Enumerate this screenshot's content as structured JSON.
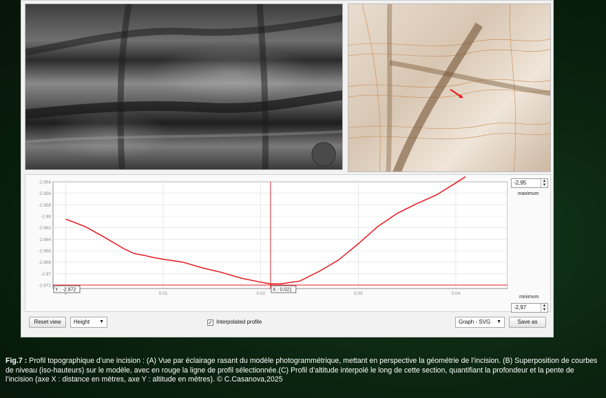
{
  "plot": {
    "y_ticks": [
      "-2.954",
      "-2.956",
      "-2.958",
      "-2.96",
      "-2.962",
      "-2.964",
      "-2.966",
      "-2.968",
      "-2.97",
      "-2.972"
    ],
    "x_ticks": [
      "0",
      "0.01",
      "0.02",
      "0.03",
      "0.04"
    ],
    "cursor_y_label": "Y : -2.972",
    "cursor_x_label": "X : 0.021",
    "line_color": "#e8141c"
  },
  "chart_data": {
    "type": "line",
    "x": [
      0,
      0.002,
      0.004,
      0.006,
      0.007,
      0.008,
      0.009,
      0.01,
      0.012,
      0.014,
      0.016,
      0.018,
      0.02,
      0.021,
      0.022,
      0.024,
      0.026,
      0.028,
      0.03,
      0.032,
      0.034,
      0.036,
      0.038,
      0.04,
      0.041
    ],
    "y": [
      -2.9605,
      -2.9618,
      -2.9637,
      -2.9657,
      -2.9665,
      -2.9668,
      -2.9672,
      -2.9675,
      -2.968,
      -2.969,
      -2.9698,
      -2.9708,
      -2.9715,
      -2.9718,
      -2.9718,
      -2.9713,
      -2.9696,
      -2.9676,
      -2.9648,
      -2.9618,
      -2.9595,
      -2.9578,
      -2.9563,
      -2.9542,
      -2.9531
    ],
    "xlim": [
      -0.0013,
      0.0453
    ],
    "ylim": [
      -2.9726,
      -2.954
    ],
    "cursor": {
      "x": 0.021,
      "y": -2.972
    },
    "grid": true
  },
  "controls": {
    "maximum_value": "-2,95",
    "maximum_label": "maximum",
    "minimum_label": "minimum",
    "minimum_value": "-2,97",
    "reset_view": "Reset view",
    "axis_mode": "Height",
    "interpolated_label": "Interpolated profile",
    "interpolated_checked": "✓",
    "export_format": "Graph - SVG",
    "save_as": "Save as"
  },
  "caption": {
    "bold": "Fig.7 :",
    "text": " Profil topographique d’une incision : (A) Vue par éclairage rasant du modèle photogrammétrique, mettant en perspective la géométrie de l’incision. (B) Superposition de courbes de niveau (iso-hauteurs) sur le modèle, avec en rouge la ligne de profil sélectionnée.(C) Profil d’altitude interpolé le long de cette section, quantifiant la profondeur et la pente de l’incision (axe X : distance en mètres, axe Y : altitude en mètres). © C.Casanova,2025"
  }
}
